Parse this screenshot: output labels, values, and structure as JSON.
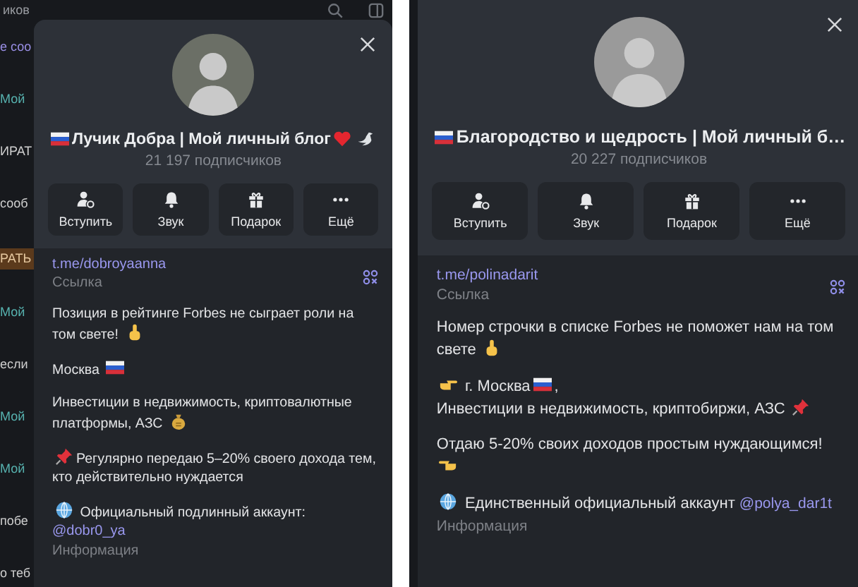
{
  "panels": [
    {
      "header_fragment": "иков",
      "background_chat": [
        {
          "kind": "link",
          "text": "е соо"
        },
        {
          "kind": "name",
          "text": "Мой"
        },
        {
          "kind": "text",
          "text": "ИРАТ"
        },
        {
          "kind": "text",
          "text": "сооб"
        },
        {
          "kind": "button",
          "text": "РАТЬ"
        },
        {
          "kind": "name",
          "text": "Мой"
        },
        {
          "kind": "text",
          "text": "если"
        },
        {
          "kind": "name",
          "text": "Мой"
        },
        {
          "kind": "name",
          "text": "Мой"
        },
        {
          "kind": "text",
          "text": "побе"
        },
        {
          "kind": "text",
          "text": "о теб"
        }
      ],
      "title": [
        {
          "kind": "flag"
        },
        {
          "kind": "text",
          "text": " Лучик Добра | Мой личный блог "
        },
        {
          "kind": "heart"
        },
        {
          "kind": "dove"
        }
      ],
      "subscribers": "21 197 подписчиков",
      "actions": [
        {
          "kind": "join",
          "label": "Вступить"
        },
        {
          "kind": "bell",
          "label": "Звук"
        },
        {
          "kind": "gift",
          "label": "Подарок"
        },
        {
          "kind": "more",
          "label": "Ещё"
        }
      ],
      "link": "t.me/dobroyaanna",
      "link_caption": "Ссылка",
      "about": [
        [
          {
            "kind": "text",
            "text": "Позиция в рейтинге Forbes не сыграет роли на том свете! "
          },
          {
            "kind": "finger"
          }
        ],
        [
          {
            "kind": "text",
            "text": "Москва "
          },
          {
            "kind": "flag"
          }
        ],
        [
          {
            "kind": "text",
            "text": "Инвестиции в недвижимость, криптовалютные платформы, АЗС "
          },
          {
            "kind": "bag"
          }
        ],
        [
          {
            "kind": "pin"
          },
          {
            "kind": "text",
            "text": "Регулярно передаю 5–20% своего дохода тем, кто действительно нуждается"
          }
        ],
        [
          {
            "kind": "globe"
          },
          {
            "kind": "text",
            "text": " Официальный подлинный аккаунт: "
          },
          {
            "kind": "link",
            "text": "@dobr0_ya"
          }
        ]
      ],
      "about_caption": "Информация"
    },
    {
      "title": [
        {
          "kind": "flag"
        },
        {
          "kind": "text",
          "text": " Благородство и щедрость | Мой личный б…"
        }
      ],
      "subscribers": "20 227 подписчиков",
      "actions": [
        {
          "kind": "join",
          "label": "Вступить"
        },
        {
          "kind": "bell",
          "label": "Звук"
        },
        {
          "kind": "gift",
          "label": "Подарок"
        },
        {
          "kind": "more",
          "label": "Ещё"
        }
      ],
      "link": "t.me/polinadarit",
      "link_caption": "Ссылка",
      "about": [
        [
          {
            "kind": "text",
            "text": "Номер строчки в списке Forbes не поможет нам на том свете "
          },
          {
            "kind": "finger"
          }
        ],
        [
          {
            "kind": "hand-right"
          },
          {
            "kind": "text",
            "text": " г. Москва"
          },
          {
            "kind": "flag"
          },
          {
            "kind": "text",
            "text": ","
          },
          {
            "kind": "break"
          },
          {
            "kind": "text",
            "text": "Инвестиции в недвижимость, криптобиржи, АЗС "
          },
          {
            "kind": "pin"
          }
        ],
        [
          {
            "kind": "text",
            "text": "Отдаю 5-20% своих доходов простым нуждающимся!"
          },
          {
            "kind": "break"
          },
          {
            "kind": "hand-left"
          }
        ],
        [
          {
            "kind": "globe"
          },
          {
            "kind": "text",
            "text": " Единственный официальный аккаунт "
          },
          {
            "kind": "link",
            "text": "@polya_dar1t"
          }
        ]
      ],
      "about_caption": "Информация"
    }
  ]
}
